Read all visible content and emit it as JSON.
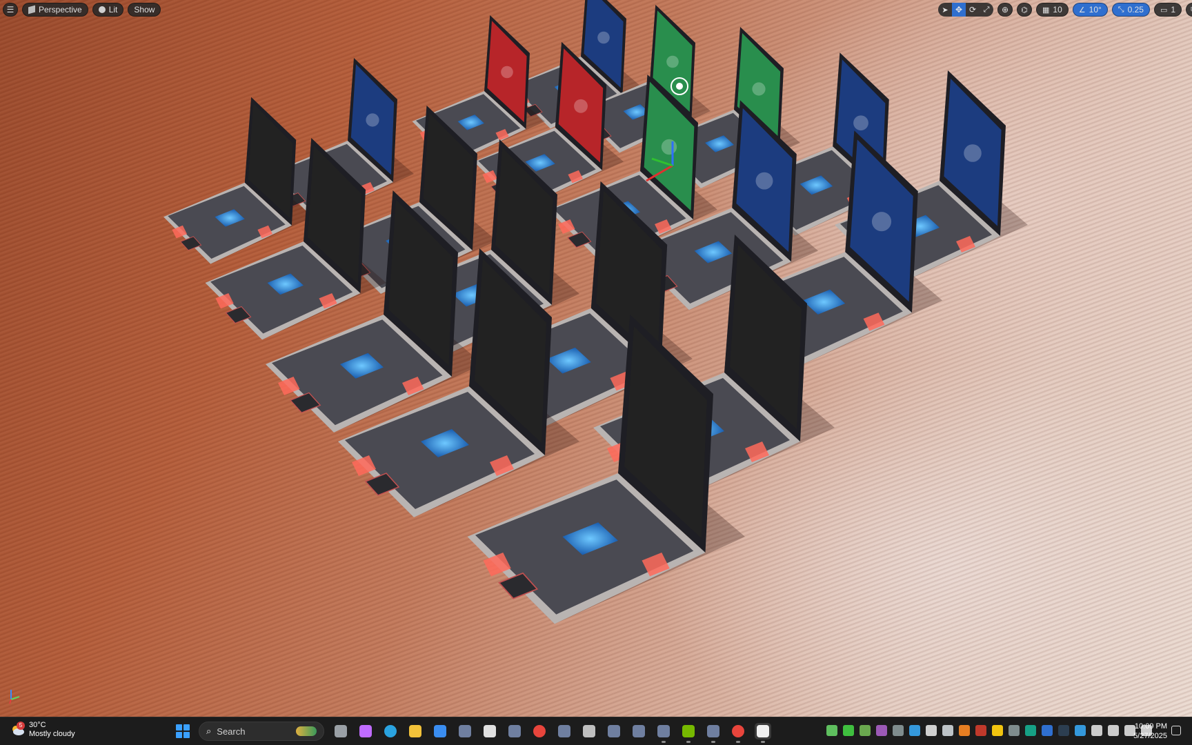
{
  "viewport": {
    "mode_label": "Perspective",
    "lighting_label": "Lit",
    "show_label": "Show",
    "grid_snap_value": "10",
    "rotation_snap_value": "10°",
    "scale_snap_value": "0.25",
    "camera_speed_value": "1"
  },
  "taskbar": {
    "weather": {
      "badge": "5",
      "temperature": "30°C",
      "condition": "Mostly cloudy"
    },
    "search_label": "Search",
    "apps": [
      "task-view",
      "copilot",
      "edge",
      "file-explorer",
      "microsoft-store",
      "app",
      "alienware",
      "app",
      "chrome",
      "app",
      "obs",
      "app",
      "app",
      "app",
      "nvidia",
      "app",
      "chrome",
      "unreal-engine"
    ],
    "time": "10:09 PM",
    "date": "5/27/2025"
  },
  "colors": {
    "accent": "#2f6fcf",
    "screen_blue": "#1c3f8a",
    "screen_red": "#c8262a",
    "screen_green": "#2a9a52",
    "key_glow": "#ff6a5a",
    "trackpad_glow": "#5cc0ff",
    "ground_dark": "#a8502f",
    "ground_light": "#e8d6cc"
  }
}
